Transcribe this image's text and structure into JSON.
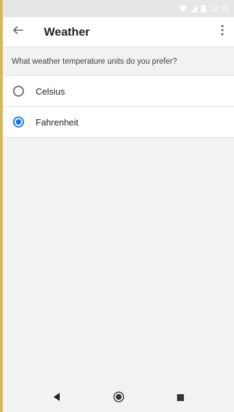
{
  "status_bar": {
    "time": "12:30",
    "wifi_icon": "wifi-icon",
    "signal_icon": "signal-icon",
    "battery_icon": "battery-icon",
    "text_color": "#ffffff"
  },
  "app_bar": {
    "title": "Weather",
    "back_icon": "arrow-back-icon",
    "menu_icon": "more-vert-icon"
  },
  "prompt": "What weather temperature units do you prefer?",
  "options": [
    {
      "label": "Celsius",
      "selected": false
    },
    {
      "label": "Fahrenheit",
      "selected": true
    }
  ],
  "nav_bar": {
    "back_icon": "nav-back-icon",
    "home_icon": "nav-home-icon",
    "recents_icon": "nav-recents-icon"
  },
  "colors": {
    "accent": "#1a73e8",
    "background": "#f2f2f2",
    "surface": "#ffffff"
  }
}
